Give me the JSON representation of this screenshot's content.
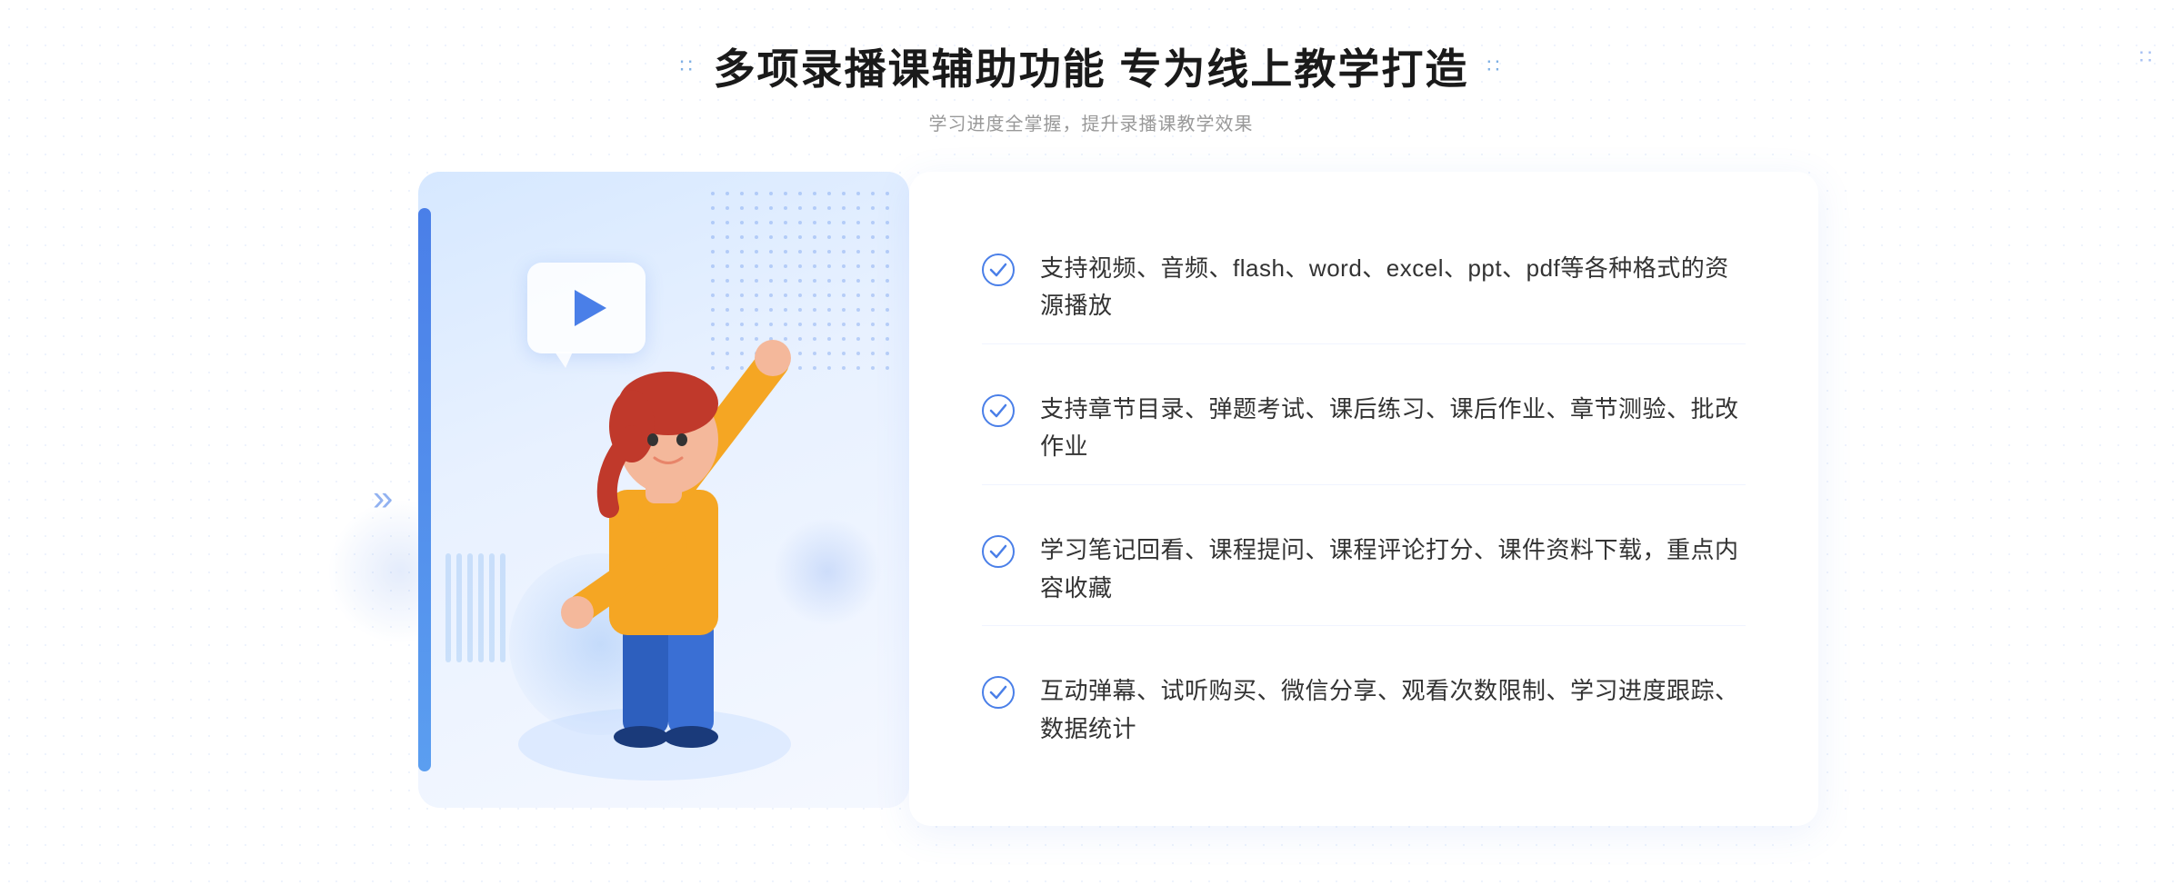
{
  "header": {
    "title_dots_left": "∷",
    "title_dots_right": "∷",
    "main_title": "多项录播课辅助功能 专为线上教学打造",
    "subtitle": "学习进度全掌握，提升录播课教学效果"
  },
  "features": [
    {
      "id": 1,
      "text": "支持视频、音频、flash、word、excel、ppt、pdf等各种格式的资源播放"
    },
    {
      "id": 2,
      "text": "支持章节目录、弹题考试、课后练习、课后作业、章节测验、批改作业"
    },
    {
      "id": 3,
      "text": "学习笔记回看、课程提问、课程评论打分、课件资料下载，重点内容收藏"
    },
    {
      "id": 4,
      "text": "互动弹幕、试听购买、微信分享、观看次数限制、学习进度跟踪、数据统计"
    }
  ],
  "colors": {
    "primary_blue": "#4a7fe8",
    "light_blue": "#7ab0f0",
    "text_dark": "#333333",
    "text_gray": "#999999"
  }
}
